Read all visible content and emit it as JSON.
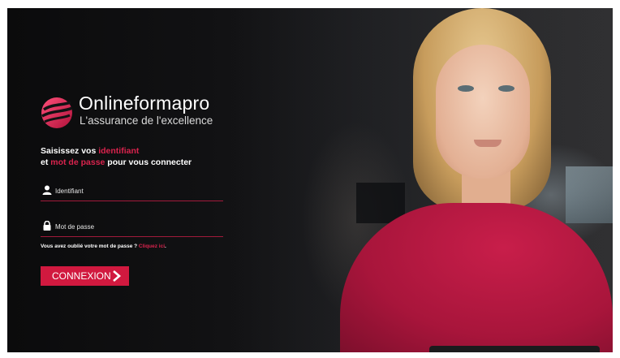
{
  "brand": {
    "name": "Onlineformapro",
    "tagline": "L'assurance de l'excellence",
    "logo_icon": "swirl-logo",
    "accent_color": "#d1193f"
  },
  "login": {
    "heading_prefix": "Saisissez vos ",
    "heading_highlight1": "identifiant",
    "heading_line2_prefix": "et ",
    "heading_highlight2": "mot de passe",
    "heading_suffix": " pour vous connecter",
    "username_placeholder": "Identifiant",
    "username_icon": "user-icon",
    "password_placeholder": "Mot de passe",
    "password_icon": "lock-icon",
    "forgot_text": "Vous avez oublié votre mot de passe ? ",
    "forgot_link": "Cliquez ici",
    "forgot_end": ".",
    "submit_label": "CONNEXION",
    "submit_icon": "chevron-right-icon"
  }
}
